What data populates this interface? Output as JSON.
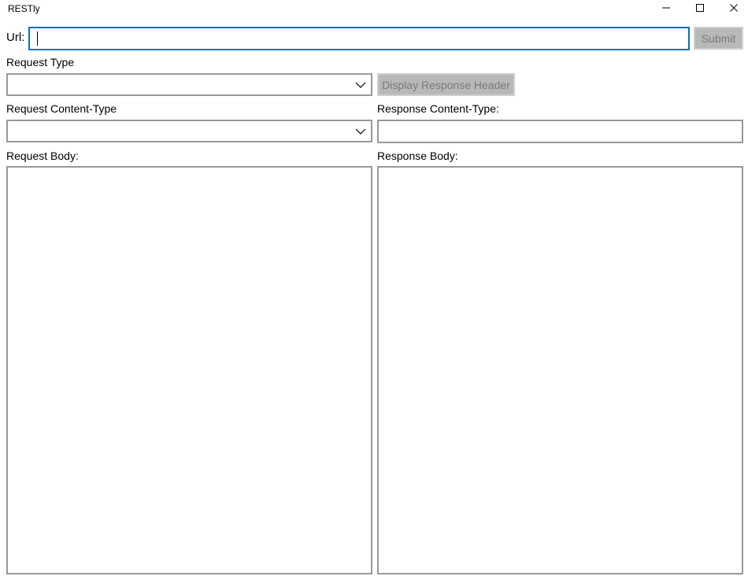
{
  "window": {
    "title": "RESTly",
    "controls": {
      "minimize_icon": "minimize-icon",
      "maximize_icon": "maximize-icon",
      "close_icon": "close-icon"
    }
  },
  "url_row": {
    "label": "Url:",
    "value": "",
    "submit_label": "Submit"
  },
  "request_type": {
    "label": "Request Type",
    "selected": ""
  },
  "display_response_header_label": "Display Response Header",
  "request_content_type": {
    "label": "Request Content-Type",
    "selected": ""
  },
  "response_content_type": {
    "label": "Response Content-Type:",
    "value": ""
  },
  "request_body": {
    "label": "Request Body:",
    "value": ""
  },
  "response_body": {
    "label": "Response Body:",
    "value": ""
  },
  "colors": {
    "focus_border": "#0a6fc2",
    "control_border": "#999999",
    "disabled_button_bg": "#b8b8b8",
    "disabled_button_text": "#7a7a7a"
  }
}
